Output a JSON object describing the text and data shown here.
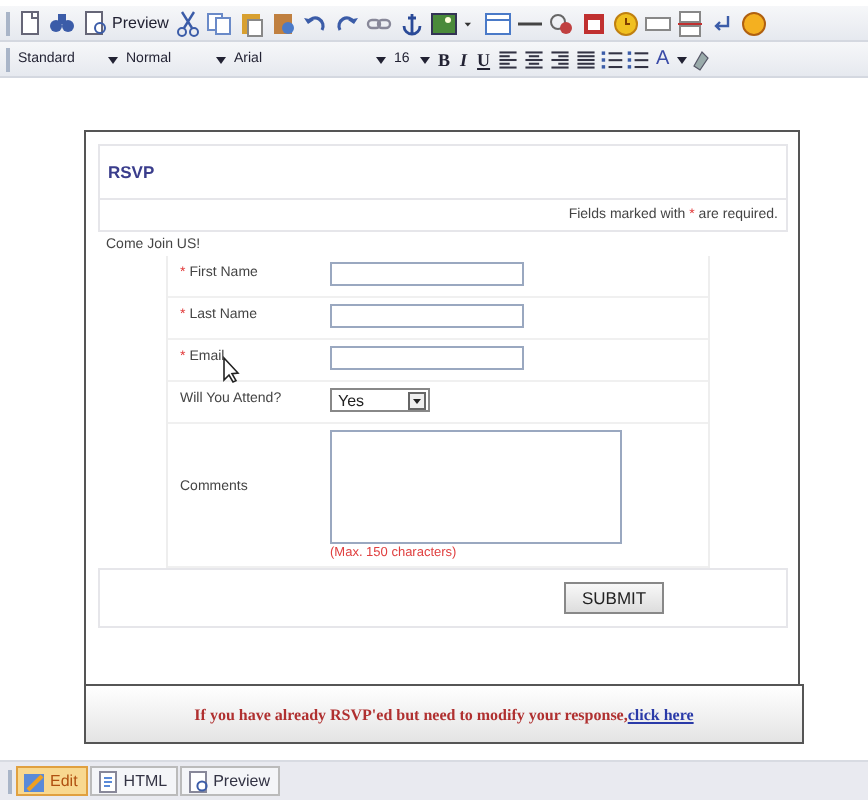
{
  "toolbar": {
    "preview_label": "Preview"
  },
  "format_bar": {
    "dropdowns": [
      {
        "value": "Standard",
        "kind": "wide"
      },
      {
        "value": "Normal",
        "kind": "wide"
      },
      {
        "value": "Arial",
        "kind": "long"
      },
      {
        "value": "16",
        "kind": "narrow"
      }
    ],
    "style_buttons": [
      "B",
      "I",
      "U"
    ],
    "font_color_button": "A"
  },
  "form": {
    "title": "RSVP",
    "required_note": {
      "before": "Fields marked with",
      "mark": "*",
      "after": "are required."
    },
    "intro": "Come Join US!",
    "fields": [
      {
        "kind": "text",
        "mark": "*",
        "label": "First Name"
      },
      {
        "kind": "text",
        "mark": "*",
        "label": "Last Name"
      },
      {
        "kind": "text",
        "mark": "*",
        "label": "Email"
      },
      {
        "kind": "select",
        "label": "Will You Attend?",
        "value": "Yes"
      },
      {
        "kind": "textarea",
        "label": "Comments",
        "hint": "(Max. 150 characters)"
      }
    ],
    "submit": "SUBMIT"
  },
  "notice": {
    "text": "If you have already RSVP'ed but need to modify your response,",
    "link": "click here"
  },
  "view_tabs": [
    {
      "label": "Edit",
      "selected": true
    },
    {
      "label": "HTML",
      "selected": false
    },
    {
      "label": "Preview",
      "selected": false
    }
  ]
}
